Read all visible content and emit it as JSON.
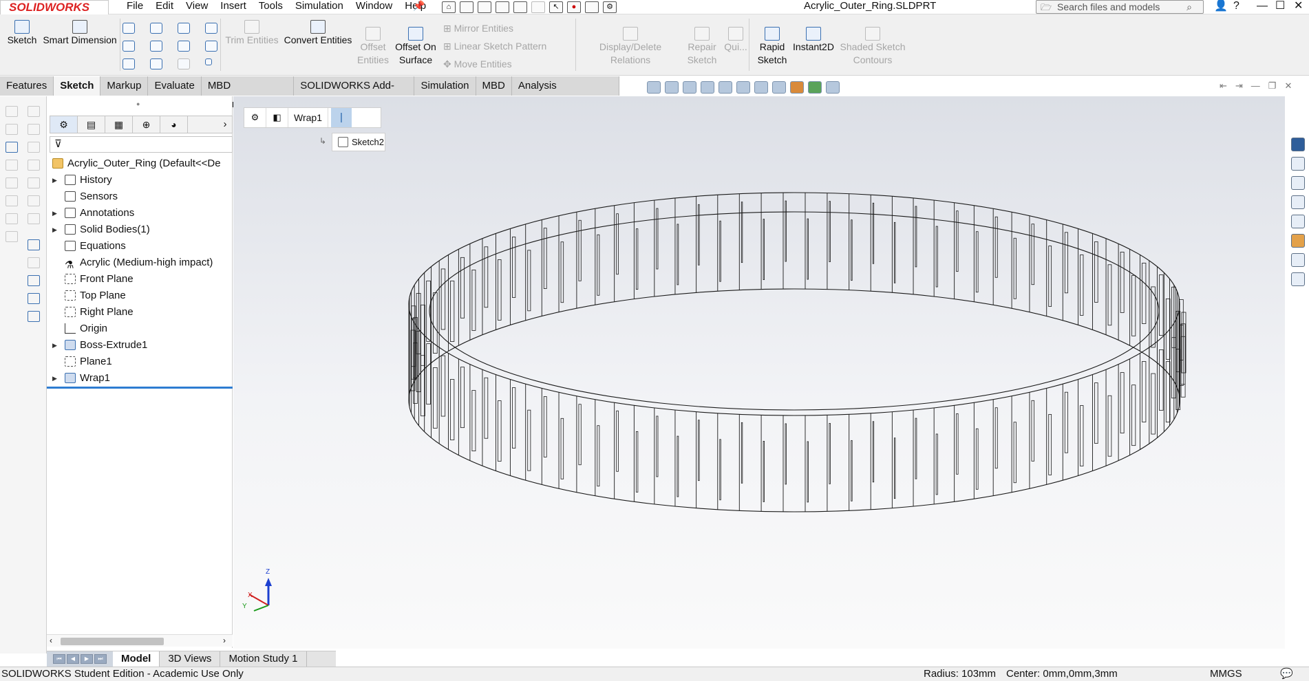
{
  "app": {
    "logo": "SOLIDWORKS",
    "document_title": "Acrylic_Outer_Ring.SLDPRT"
  },
  "menu": [
    "File",
    "Edit",
    "View",
    "Insert",
    "Tools",
    "Simulation",
    "Window",
    "Help"
  ],
  "search": {
    "placeholder": "Search files and models"
  },
  "command_manager": {
    "sketch": "Sketch",
    "smart_dimension": "Smart Dimension",
    "trim_entities": "Trim Entities",
    "convert_entities": "Convert Entities",
    "offset_entities_1": "Offset",
    "offset_entities_2": "Entities",
    "offset_on_surface_1": "Offset On",
    "offset_on_surface_2": "Surface",
    "mirror_entities": "Mirror Entities",
    "linear_sketch_pattern": "Linear Sketch Pattern",
    "move_entities": "Move Entities",
    "display_delete_relations": "Display/Delete Relations",
    "repair_sketch_1": "Repair",
    "repair_sketch_2": "Sketch",
    "quick_snaps": "Qui...",
    "rapid_sketch_1": "Rapid",
    "rapid_sketch_2": "Sketch",
    "instant2d": "Instant2D",
    "shaded_sketch_contours_1": "Shaded Sketch",
    "shaded_sketch_contours_2": "Contours"
  },
  "tabs": [
    "Features",
    "Sketch",
    "Markup",
    "Evaluate",
    "MBD Dimensions",
    "SOLIDWORKS Add-Ins",
    "Simulation",
    "MBD",
    "Analysis Preparation"
  ],
  "active_tab": "Sketch",
  "feature_tree": {
    "root": "Acrylic_Outer_Ring  (Default<<De",
    "items": [
      {
        "label": "History",
        "expandable": true
      },
      {
        "label": "Sensors",
        "expandable": false
      },
      {
        "label": "Annotations",
        "expandable": true
      },
      {
        "label": "Solid Bodies(1)",
        "expandable": true
      },
      {
        "label": "Equations",
        "expandable": false
      },
      {
        "label": "Acrylic (Medium-high impact)",
        "expandable": false
      },
      {
        "label": "Front Plane",
        "expandable": false
      },
      {
        "label": "Top Plane",
        "expandable": false
      },
      {
        "label": "Right Plane",
        "expandable": false
      },
      {
        "label": "Origin",
        "expandable": false
      },
      {
        "label": "Boss-Extrude1",
        "expandable": true
      },
      {
        "label": "Plane1",
        "expandable": false
      },
      {
        "label": "Wrap1",
        "expandable": true
      }
    ]
  },
  "breadcrumb": {
    "feature": "Wrap1",
    "sketch": "Sketch2"
  },
  "triad": {
    "x": "X",
    "y": "Y",
    "z": "Z"
  },
  "bottom_tabs": [
    "Model",
    "3D Views",
    "Motion Study 1"
  ],
  "active_bottom_tab": "Model",
  "status": {
    "left": "SOLIDWORKS Student Edition - Academic Use Only",
    "radius": "Radius: 103mm",
    "center": "Center: 0mm,0mm,3mm",
    "units": "MMGS"
  },
  "colors": {
    "accent": "#2d7cd1",
    "logo_red": "#dd2222",
    "ring_line": "#1a1a1a"
  }
}
